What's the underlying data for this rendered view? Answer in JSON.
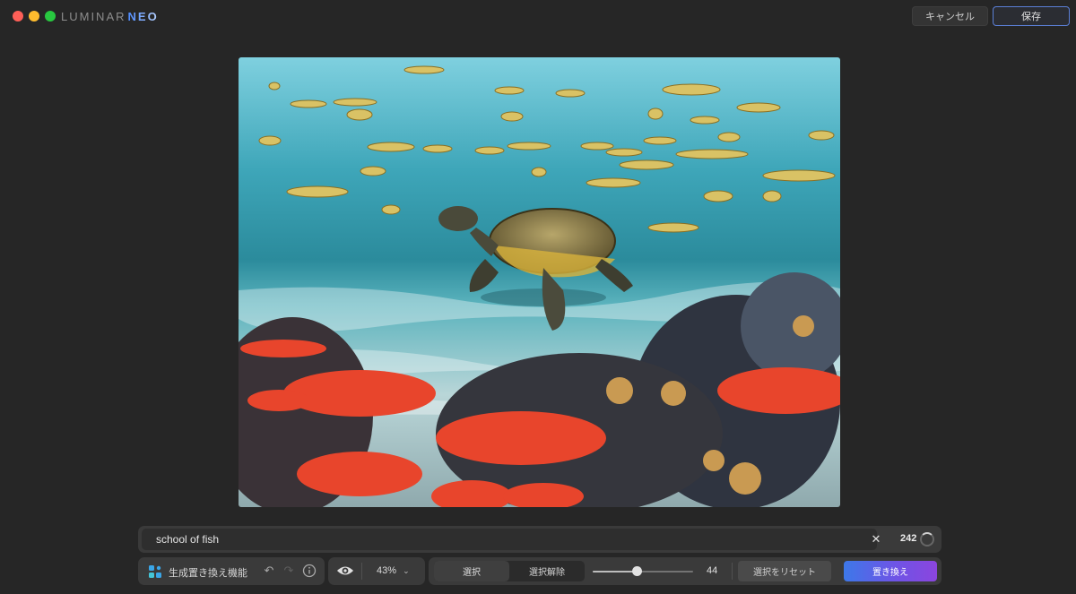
{
  "app": {
    "logo_word1": "LUMINAR",
    "logo_word2": "NEO"
  },
  "header": {
    "cancel_label": "キャンセル",
    "save_label": "保存"
  },
  "canvas": {
    "image_description": "underwater scene with sea turtle, school of fish, and red coral"
  },
  "prompt": {
    "value": "school of fish",
    "count": "242"
  },
  "toolbar": {
    "gen_label": "生成置き換え機能",
    "zoom_label": "43%",
    "select_label": "選択",
    "deselect_label": "選択解除",
    "brush_size": "44",
    "brush_size_fraction": 0.44,
    "reset_label": "選択をリセット",
    "replace_label": "置き換え"
  },
  "icons": {
    "gen": "generative-replace-icon",
    "undo": "undo-icon",
    "redo": "redo-icon",
    "info": "info-icon",
    "eye": "eye-icon",
    "zoom_chevron": "chevron-down-icon",
    "clear": "close-icon",
    "spinner": "progress-ring-icon"
  },
  "colors": {
    "accent_start": "#3d78e8",
    "accent_end": "#8b45de",
    "save_border": "#5b7fd6"
  }
}
